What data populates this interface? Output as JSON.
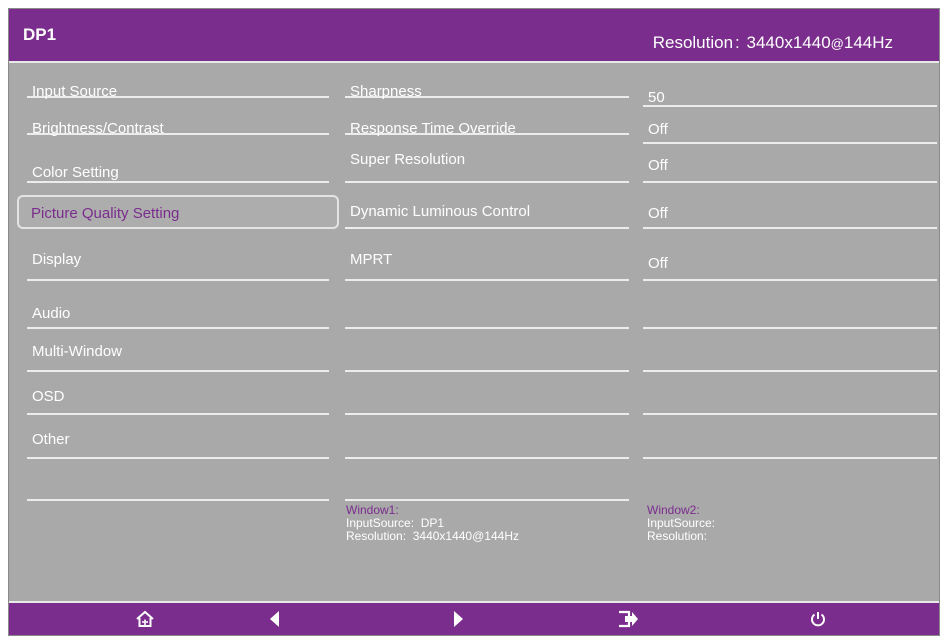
{
  "header": {
    "title": "DP1",
    "resolution_label": "Resolution",
    "resolution_value": "3440x1440",
    "refresh": "144Hz"
  },
  "menu": {
    "items": [
      {
        "label": "Input Source"
      },
      {
        "label": "Brightness/Contrast"
      },
      {
        "label": "Color Setting"
      },
      {
        "label": "Picture Quality Setting",
        "selected": true
      },
      {
        "label": "Display"
      },
      {
        "label": "Audio"
      },
      {
        "label": "Multi-Window"
      },
      {
        "label": "OSD"
      },
      {
        "label": "Other"
      }
    ]
  },
  "settings": [
    {
      "name": "Sharpness",
      "value": "50"
    },
    {
      "name": "Response Time Override",
      "value": "Off"
    },
    {
      "name": "Super Resolution",
      "value": "Off"
    },
    {
      "name": "Dynamic Luminous Control",
      "value": "Off"
    },
    {
      "name": "MPRT",
      "value": "Off"
    }
  ],
  "window1": {
    "title": "Window1:",
    "input_label": "InputSource:",
    "input_value": "DP1",
    "res_label": "Resolution:",
    "res_value": "3440x1440",
    "res_refresh": "144Hz"
  },
  "window2": {
    "title": "Window2:",
    "input_label": "InputSource:",
    "res_label": "Resolution:"
  },
  "footer": {
    "icons": [
      "home-icon",
      "left-arrow-icon",
      "right-arrow-icon",
      "exit-icon",
      "power-icon"
    ]
  },
  "colors": {
    "accent": "#7b2d8e",
    "panel": "#a9a9a9",
    "text": "#ffffff",
    "divider": "#ececec"
  }
}
